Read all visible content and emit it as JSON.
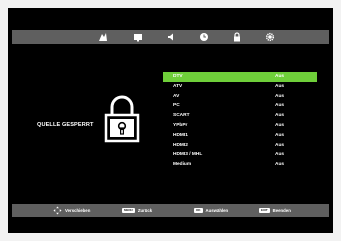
{
  "menu_icons": [
    {
      "name": "picture-icon"
    },
    {
      "name": "screen-icon"
    },
    {
      "name": "sound-icon"
    },
    {
      "name": "timer-icon"
    },
    {
      "name": "lock-icon"
    },
    {
      "name": "settings-icon"
    }
  ],
  "lock_panel": {
    "label": "QUELLE GESPERRT",
    "icon": "padlock-icon"
  },
  "sources": [
    {
      "name": "DTV",
      "value": "Aus",
      "selected": true
    },
    {
      "name": "ATV",
      "value": "Aus"
    },
    {
      "name": "AV",
      "value": "Aus"
    },
    {
      "name": "PC",
      "value": "Aus"
    },
    {
      "name": "SCART",
      "value": "Aus"
    },
    {
      "name": "YPbPr",
      "value": "Aus"
    },
    {
      "name": "HDMI1",
      "value": "Aus"
    },
    {
      "name": "HDMI2",
      "value": "Aus"
    },
    {
      "name": "HDMI3 / MHL",
      "value": "Aus"
    },
    {
      "name": "Medium",
      "value": "Aus"
    }
  ],
  "hints": {
    "move": {
      "label": "Verschieben",
      "key": "",
      "icon": "dpad-icon"
    },
    "back": {
      "label": "Zurück",
      "key": "MENU"
    },
    "select": {
      "label": "Auswählen",
      "key": "OK"
    },
    "exit": {
      "label": "Beenden",
      "key": "EXIT"
    }
  },
  "colors": {
    "highlight": "#6fcf3a",
    "bar": "#5f5f5f",
    "background": "#000000"
  }
}
